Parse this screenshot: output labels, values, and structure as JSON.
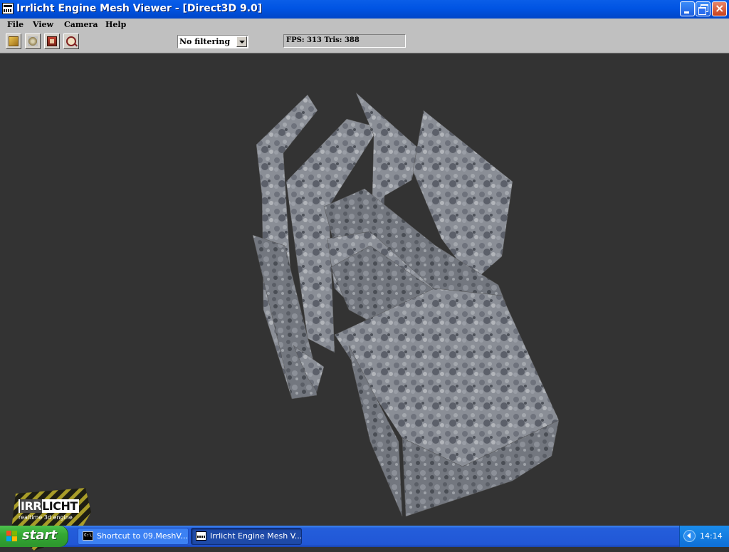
{
  "window": {
    "title": "Irrlicht Engine Mesh Viewer - [Direct3D 9.0]",
    "icon": "irrlicht-app-icon",
    "controls": [
      "minimize-icon",
      "restore-icon",
      "close-icon"
    ]
  },
  "menu": {
    "items": [
      "File",
      "View",
      "Camera",
      "Help"
    ]
  },
  "toolbar": {
    "buttons": [
      {
        "icon": "open-folder-icon"
      },
      {
        "icon": "settings-wrench-icon"
      },
      {
        "icon": "model-info-icon"
      },
      {
        "icon": "zoom-magnifier-icon"
      }
    ],
    "filter_select": {
      "selected": "No filtering"
    },
    "status": "FPS: 313 Tris: 388"
  },
  "viewport": {
    "background": "#333333",
    "logo": {
      "word_a": "IRR",
      "word_b": "LICHT",
      "tagline": "realtime 3d engine"
    }
  },
  "taskbar": {
    "start_label": "start",
    "tasks": [
      {
        "label": "Shortcut to 09.MeshV...",
        "icon": "cmd-icon",
        "active": false
      },
      {
        "label": "Irrlicht Engine Mesh V...",
        "icon": "irrlicht-app-icon",
        "active": true
      }
    ],
    "clock": "14:14",
    "colors": {
      "taskbar": "#245edb",
      "start": "#34a834",
      "tray": "#0e6fd6"
    }
  }
}
